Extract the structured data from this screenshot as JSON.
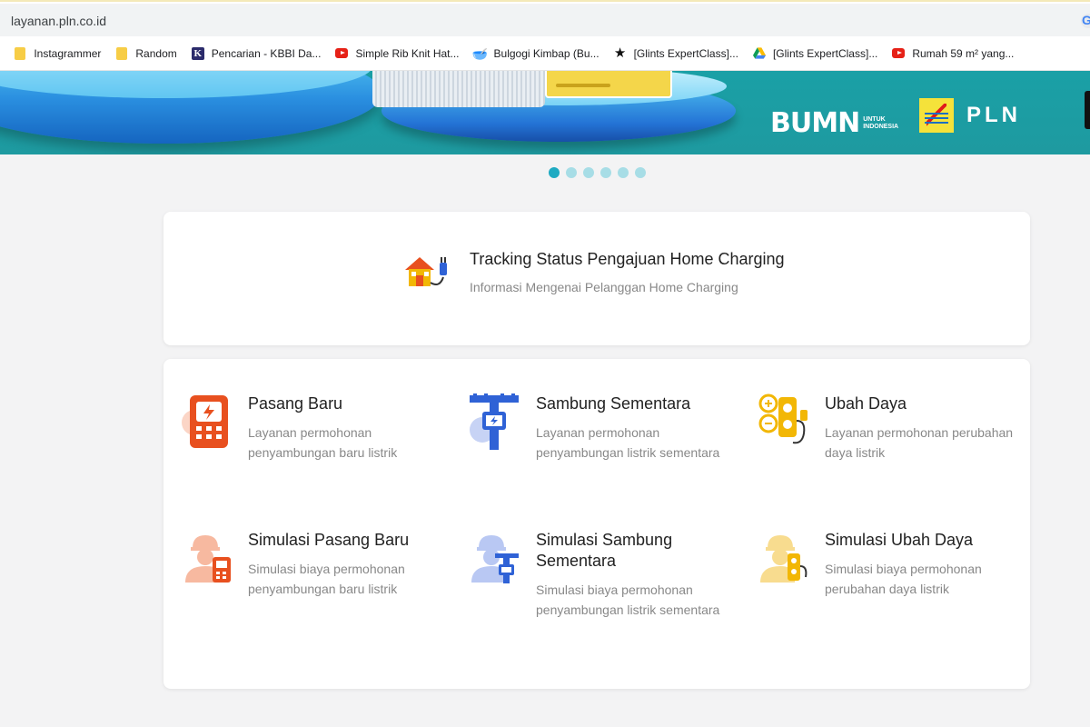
{
  "browser": {
    "url": "layanan.pln.co.id",
    "bookmarks": [
      {
        "label": "Instagrammer",
        "icon": "folder-icon"
      },
      {
        "label": "Random",
        "icon": "folder-icon"
      },
      {
        "label": "Pencarian - KBBI Da...",
        "icon": "kbbi-icon"
      },
      {
        "label": "Simple Rib Knit Hat...",
        "icon": "youtube-icon"
      },
      {
        "label": "Bulgogi Kimbap (Bu...",
        "icon": "bowl-icon"
      },
      {
        "label": "[Glints ExpertClass]...",
        "icon": "star-icon"
      },
      {
        "label": "[Glints ExpertClass]...",
        "icon": "drive-icon"
      },
      {
        "label": "Rumah 59 m² yang...",
        "icon": "youtube-icon"
      }
    ]
  },
  "banner": {
    "bumn_word": "BUMN",
    "bumn_sub_1": "UNTUK",
    "bumn_sub_2": "INDONESIA",
    "pln_word": "PLN",
    "slides_total": 6,
    "active_slide": 1
  },
  "tracking": {
    "title": "Tracking Status Pengajuan Home Charging",
    "subtitle": "Informasi Mengenai Pelanggan Home Charging"
  },
  "services": [
    {
      "title": "Pasang Baru",
      "desc": "Layanan permohonan penyambungan baru listrik",
      "color": "#e8501f"
    },
    {
      "title": "Sambung Sementara",
      "desc": "Layanan permohonan penyambungan listrik sementara",
      "color": "#2f62d6"
    },
    {
      "title": "Ubah Daya",
      "desc": "Layanan permohonan perubahan daya listrik",
      "color": "#f2b705"
    },
    {
      "title": "Simulasi Pasang Baru",
      "desc": "Simulasi biaya permohonan penyambungan baru listrik",
      "color": "#e8501f"
    },
    {
      "title": "Simulasi Sambung Sementara",
      "desc": "Simulasi biaya permohonan penyambungan listrik sementara",
      "color": "#2f62d6"
    },
    {
      "title": "Simulasi Ubah Daya",
      "desc": "Simulasi biaya permohonan perubahan daya listrik",
      "color": "#f2b705"
    }
  ]
}
